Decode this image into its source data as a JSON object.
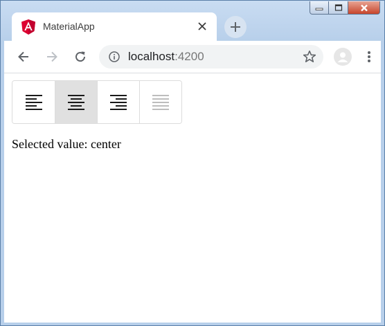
{
  "browser": {
    "tab": {
      "title": "MaterialApp",
      "favicon": "angular-logo-icon"
    },
    "address_bar": {
      "host": "localhost",
      "port": ":4200"
    },
    "colors": {
      "tab_strip": "#b7cfea",
      "omnibox": "#f1f3f4",
      "close_button": "#c7452c"
    }
  },
  "button_toggle_group": {
    "buttons": [
      {
        "icon": "format-align-left-icon",
        "checked": false,
        "disabled": false
      },
      {
        "icon": "format-align-center-icon",
        "checked": true,
        "disabled": false
      },
      {
        "icon": "format-align-right-icon",
        "checked": false,
        "disabled": false
      },
      {
        "icon": "format-align-justify-icon",
        "checked": false,
        "disabled": true
      }
    ],
    "colors": {
      "checked_background": "#e0e0e0",
      "disabled_icon": "#bdbdbd"
    }
  },
  "result": {
    "label": "Selected value:",
    "value": "center"
  }
}
